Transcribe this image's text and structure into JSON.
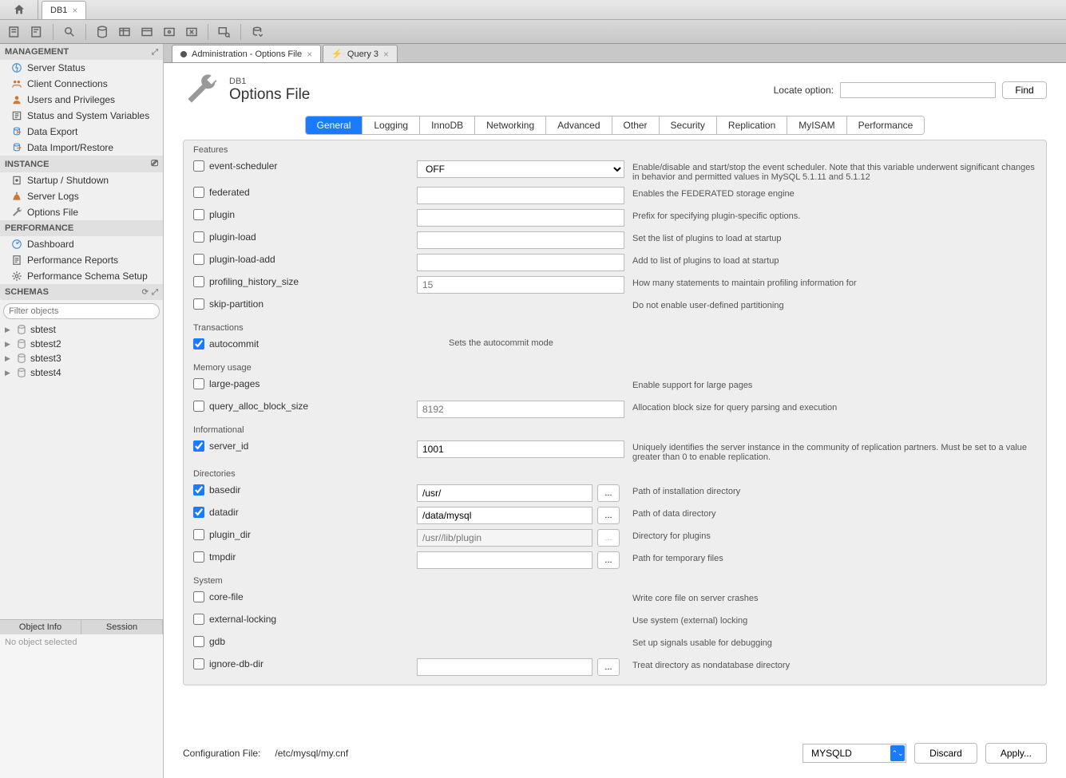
{
  "top_tabs": {
    "home": "⌂",
    "conn": "DB1"
  },
  "editor_tabs": [
    {
      "label": "Administration - Options File",
      "active": true
    },
    {
      "label": "Query 3",
      "active": false
    }
  ],
  "sidebar": {
    "management": {
      "header": "MANAGEMENT",
      "items": [
        {
          "icon": "status",
          "label": "Server Status"
        },
        {
          "icon": "conn",
          "label": "Client Connections"
        },
        {
          "icon": "users",
          "label": "Users and Privileges"
        },
        {
          "icon": "vars",
          "label": "Status and System Variables"
        },
        {
          "icon": "export",
          "label": "Data Export"
        },
        {
          "icon": "import",
          "label": "Data Import/Restore"
        }
      ]
    },
    "instance": {
      "header": "INSTANCE",
      "items": [
        {
          "icon": "startup",
          "label": "Startup / Shutdown"
        },
        {
          "icon": "logs",
          "label": "Server Logs"
        },
        {
          "icon": "opts",
          "label": "Options File"
        }
      ]
    },
    "performance": {
      "header": "PERFORMANCE",
      "items": [
        {
          "icon": "dash",
          "label": "Dashboard"
        },
        {
          "icon": "reports",
          "label": "Performance Reports"
        },
        {
          "icon": "schema",
          "label": "Performance Schema Setup"
        }
      ]
    },
    "schemas": {
      "header": "SCHEMAS",
      "filter_placeholder": "Filter objects",
      "items": [
        "sbtest",
        "sbtest2",
        "sbtest3",
        "sbtest4"
      ]
    },
    "bottom_tabs": [
      "Object Info",
      "Session"
    ],
    "bottom_msg": "No object selected"
  },
  "page": {
    "context": "DB1",
    "title": "Options File",
    "locate_label": "Locate option:",
    "find_btn": "Find"
  },
  "opt_tabs": [
    "General",
    "Logging",
    "InnoDB",
    "Networking",
    "Advanced",
    "Other",
    "Security",
    "Replication",
    "MyISAM",
    "Performance"
  ],
  "opt_tabs_active": 0,
  "groups": [
    {
      "label": "Features",
      "rows": [
        {
          "name": "event-scheduler",
          "checked": false,
          "input": {
            "type": "select",
            "value": "OFF"
          },
          "desc": "Enable/disable and start/stop the event scheduler. Note that this variable underwent significant changes in behavior and permitted values in MySQL 5.1.11 and 5.1.12"
        },
        {
          "name": "federated",
          "checked": false,
          "input": {
            "type": "text",
            "value": ""
          },
          "desc": "Enables the FEDERATED storage engine"
        },
        {
          "name": "plugin",
          "checked": false,
          "input": {
            "type": "text",
            "value": ""
          },
          "desc": "Prefix for specifying plugin-specific options."
        },
        {
          "name": "plugin-load",
          "checked": false,
          "input": {
            "type": "text",
            "value": ""
          },
          "desc": "Set the list of plugins to load at startup"
        },
        {
          "name": "plugin-load-add",
          "checked": false,
          "input": {
            "type": "text",
            "value": ""
          },
          "desc": "Add to list of plugins to load at startup"
        },
        {
          "name": "profiling_history_size",
          "checked": false,
          "input": {
            "type": "text",
            "value": "",
            "placeholder": "15"
          },
          "desc": "How many statements to maintain profiling information for"
        },
        {
          "name": "skip-partition",
          "checked": false,
          "input": null,
          "desc": "Do not enable user-defined partitioning"
        }
      ]
    },
    {
      "label": "Transactions",
      "rows": [
        {
          "name": "autocommit",
          "checked": true,
          "input": null,
          "desc_center": "Sets the autocommit mode"
        }
      ]
    },
    {
      "label": "Memory usage",
      "rows": [
        {
          "name": "large-pages",
          "checked": false,
          "input": null,
          "desc": "Enable support for large pages"
        },
        {
          "name": "query_alloc_block_size",
          "checked": false,
          "input": {
            "type": "text",
            "value": "",
            "placeholder": "8192"
          },
          "desc": "Allocation block size for query parsing and execution"
        }
      ]
    },
    {
      "label": "Informational",
      "rows": [
        {
          "name": "server_id",
          "checked": true,
          "input": {
            "type": "text",
            "value": "1001"
          },
          "desc": "Uniquely identifies the server instance in the community of replication partners. Must be set to a value greater than 0 to enable replication."
        }
      ]
    },
    {
      "label": "Directories",
      "rows": [
        {
          "name": "basedir",
          "checked": true,
          "input": {
            "type": "path",
            "value": "/usr/"
          },
          "desc": "Path of installation directory"
        },
        {
          "name": "datadir",
          "checked": true,
          "input": {
            "type": "path",
            "value": "/data/mysql"
          },
          "desc": "Path of data directory"
        },
        {
          "name": "plugin_dir",
          "checked": false,
          "input": {
            "type": "path",
            "value": "",
            "placeholder": "/usr//lib/plugin",
            "disabled": true
          },
          "desc": "Directory for plugins"
        },
        {
          "name": "tmpdir",
          "checked": false,
          "input": {
            "type": "path",
            "value": ""
          },
          "desc": "Path for temporary files"
        }
      ]
    },
    {
      "label": "System",
      "rows": [
        {
          "name": "core-file",
          "checked": false,
          "input": null,
          "desc": "Write core file on server crashes"
        },
        {
          "name": "external-locking",
          "checked": false,
          "input": null,
          "desc": "Use system (external) locking"
        },
        {
          "name": "gdb",
          "checked": false,
          "input": null,
          "desc": "Set up signals usable for debugging"
        },
        {
          "name": "ignore-db-dir",
          "checked": false,
          "input": {
            "type": "path",
            "value": ""
          },
          "desc": "Treat directory as nondatabase directory"
        }
      ]
    }
  ],
  "footer": {
    "cfg_label": "Configuration File:",
    "cfg_path": "/etc/mysql/my.cnf",
    "section": "MYSQLD",
    "discard": "Discard",
    "apply": "Apply..."
  }
}
